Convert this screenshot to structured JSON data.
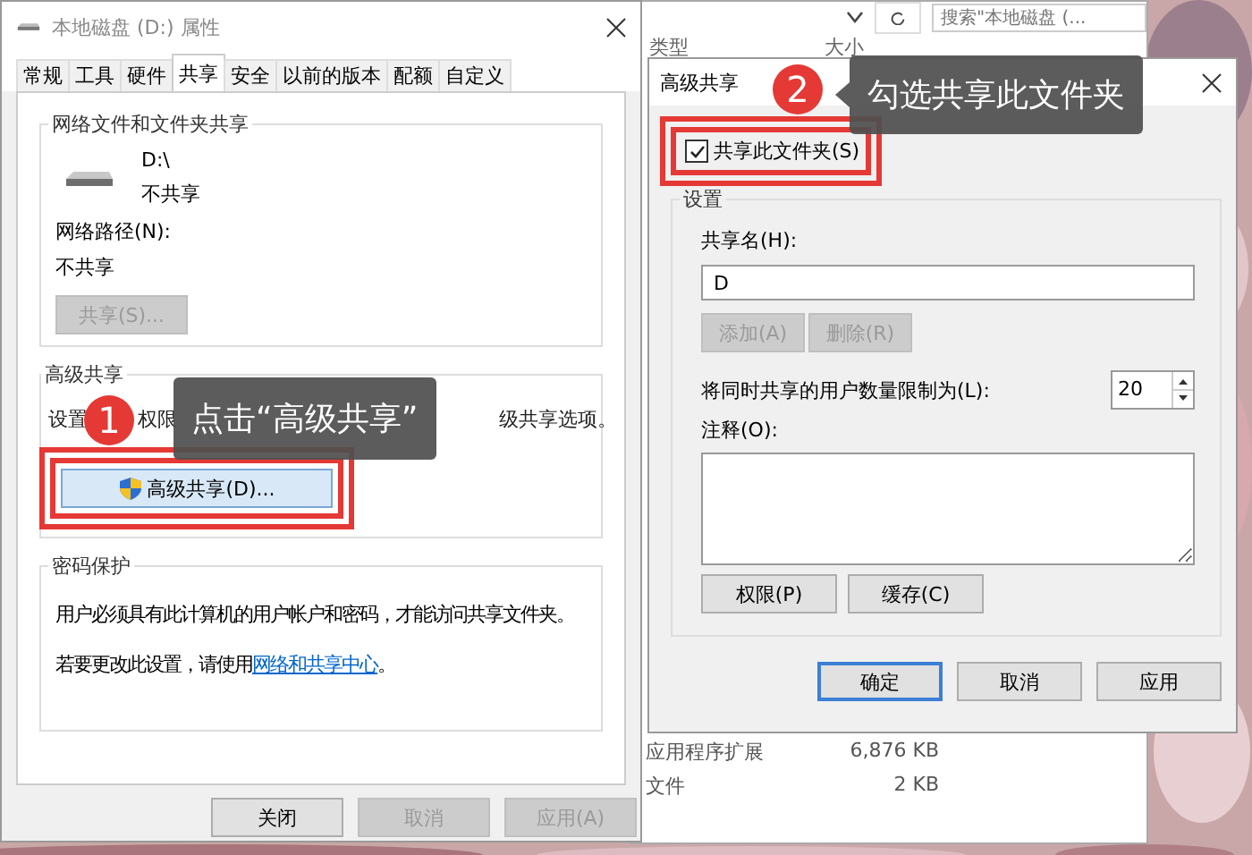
{
  "explorer": {
    "search_placeholder": "搜索\"本地磁盘 (...",
    "columns": [
      "类型",
      "大小"
    ],
    "rows": [
      {
        "type": "应用程序扩展",
        "size": "6,876 KB"
      },
      {
        "type": "文件",
        "size": "2 KB"
      }
    ]
  },
  "properties_dialog": {
    "title": "本地磁盘 (D:) 属性",
    "tabs": [
      {
        "label": "常规",
        "selected": false
      },
      {
        "label": "工具",
        "selected": false
      },
      {
        "label": "硬件",
        "selected": false
      },
      {
        "label": "共享",
        "selected": true
      },
      {
        "label": "安全",
        "selected": false
      },
      {
        "label": "以前的版本",
        "selected": false
      },
      {
        "label": "配额",
        "selected": false
      },
      {
        "label": "自定义",
        "selected": false
      }
    ],
    "network_sharing": {
      "title": "网络文件和文件夹共享",
      "drive_path": "D:\\",
      "drive_status": "不共享",
      "network_path_label": "网络路径(N):",
      "network_path_value": "不共享",
      "share_button": {
        "label": "共享(S)...",
        "disabled": true
      }
    },
    "advanced_sharing": {
      "title": "高级共享",
      "description_parts": [
        "设置",
        "权限",
        "级共享选项。"
      ],
      "button": {
        "label": "高级共享(D)...",
        "highlighted": true
      }
    },
    "password_protection": {
      "title": "密码保护",
      "text": "用户必须具有此计算机的用户帐户和密码，才能访问共享文件夹。",
      "hint_before": "若要更改此设置，请使用",
      "link": "网络和共享中心",
      "hint_after": "。"
    },
    "buttons": [
      {
        "label": "关闭",
        "disabled": false
      },
      {
        "label": "取消",
        "disabled": true
      },
      {
        "label": "应用(A)",
        "disabled": true
      }
    ]
  },
  "advanced_dialog": {
    "title": "高级共享",
    "share_checkbox": {
      "label": "共享此文件夹(S)",
      "checked": true,
      "highlighted": true
    },
    "settings": {
      "title": "设置",
      "share_name_label": "共享名(H):",
      "share_name_value": "D",
      "name_buttons": [
        {
          "label": "添加(A)",
          "disabled": true
        },
        {
          "label": "删除(R)",
          "disabled": true
        }
      ],
      "user_limit_label": "将同时共享的用户数量限制为(L):",
      "user_limit_value": "20",
      "comment_label": "注释(O):",
      "buttons": [
        {
          "label": "权限(P)",
          "disabled": false
        },
        {
          "label": "缓存(C)",
          "disabled": false
        }
      ]
    },
    "buttons": [
      {
        "label": "确定",
        "default": true
      },
      {
        "label": "取消",
        "default": false
      },
      {
        "label": "应用",
        "default": false
      }
    ]
  },
  "annotations": [
    {
      "number": "1",
      "text": "点击“高级共享”"
    },
    {
      "number": "2",
      "text": "勾选共享此文件夹"
    }
  ]
}
